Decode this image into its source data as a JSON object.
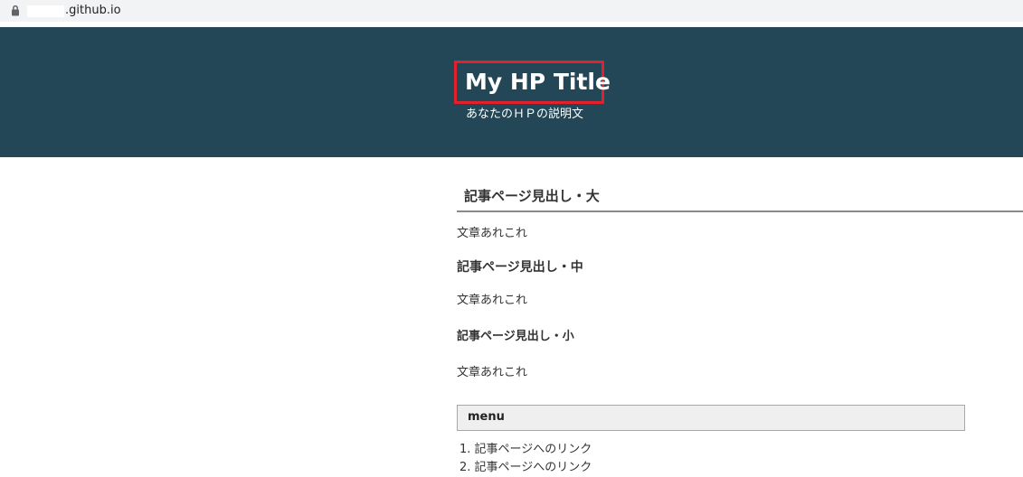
{
  "browser": {
    "url": ".github.io"
  },
  "header": {
    "title": "My HP Title",
    "description": "あなたのＨＰの説明文",
    "background_color": "#234756",
    "highlight_color": "#e3212c"
  },
  "article": {
    "heading_large": "記事ページ見出し・大",
    "text_1": "文章あれこれ",
    "heading_medium": "記事ページ見出し・中",
    "text_2": "文章あれこれ",
    "heading_small": "記事ページ見出し・小",
    "text_3": "文章あれこれ"
  },
  "menu": {
    "label": "menu",
    "items": [
      {
        "number": "1.",
        "label": "記事ページへのリンク"
      },
      {
        "number": "2.",
        "label": "記事ページへのリンク"
      }
    ]
  }
}
